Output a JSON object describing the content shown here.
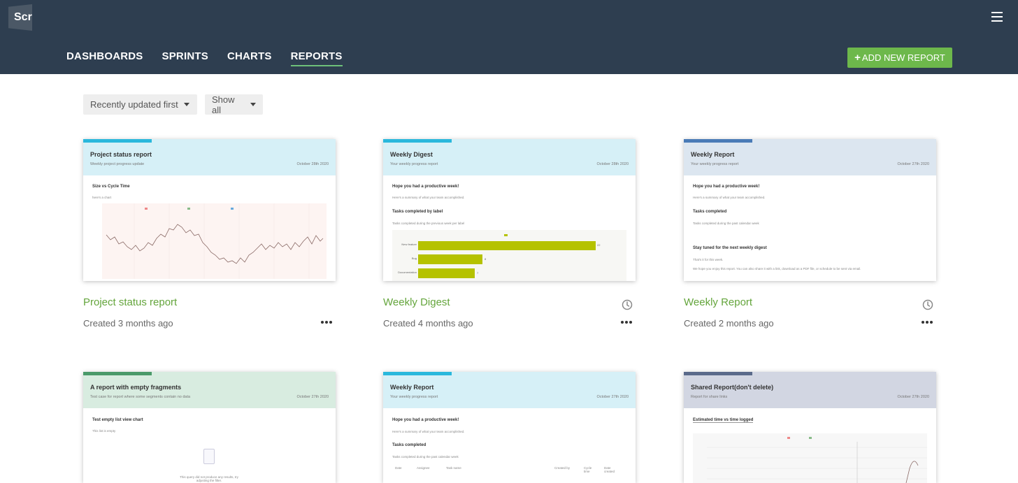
{
  "app": {
    "logo_text": "Scr"
  },
  "nav": {
    "items": [
      {
        "label": "DASHBOARDS"
      },
      {
        "label": "SPRINTS"
      },
      {
        "label": "CHARTS"
      },
      {
        "label": "REPORTS",
        "active": true
      }
    ],
    "add_button_label": "ADD NEW REPORT",
    "add_button_icon": "plus"
  },
  "filters": {
    "sort_selected": "Recently updated first",
    "show_selected": "Show all"
  },
  "colors": {
    "header_bg": "#2e3e50",
    "accent_green": "#6db84b",
    "title_green": "#64a53c"
  },
  "reports": [
    {
      "title": "Project status report",
      "created": "Created 3 months ago",
      "thumb": {
        "title": "Project status report",
        "subtitle": "Weekly project progress update",
        "date": "October 28th 2020",
        "header_color": "#d6f0f7",
        "bar_color": "#2ab8dc",
        "section": "Size vs Cycle Time",
        "note": "here's a chart"
      }
    },
    {
      "title": "Weekly Digest",
      "created": "Created 4 months ago",
      "scheduled": true,
      "thumb": {
        "title": "Weekly Digest",
        "subtitle": "Your weekly progress report",
        "date": "October 28th 2020",
        "header_color": "#d6f0f7",
        "bar_color": "#2ab8dc",
        "greeting": "Hope you had a productive week!",
        "greeting_note": "Here's a summary of what your team accomplished.",
        "section": "Tasks completed by label",
        "section_note": "Tasks completed during the previous week per label",
        "bars": [
          {
            "label": "New feature",
            "value": 22
          },
          {
            "label": "Bug",
            "value": 8
          },
          {
            "label": "Documentation",
            "value": 7
          }
        ]
      }
    },
    {
      "title": "Weekly Report",
      "created": "Created 2 months ago",
      "scheduled": true,
      "thumb": {
        "title": "Weekly Report",
        "subtitle": "Your weekly progress report",
        "date": "October 27th 2020",
        "header_color": "#dce6f0",
        "bar_color": "#4a7bb7",
        "greeting": "Hope you had a productive week!",
        "greeting_note": "Here's a summary of what your team accomplished.",
        "section": "Tasks completed",
        "section_note": "Tasks completed during the past calendar week",
        "footer_title": "Stay tuned for the next weekly digest",
        "footer_note": "That's it for this week.",
        "footer_note2": "We hope you enjoy this report. You can also share it with a link, download as a PDF file, or schedule to be sent via email."
      }
    },
    {
      "title": "",
      "created": "",
      "thumb": {
        "title": "A report with empty fragments",
        "subtitle": "Test case for report where some segments contain no data",
        "date": "October 27th 2020",
        "header_color": "#d8ece0",
        "bar_color": "#4a9a6a",
        "section": "Test empty list view chart",
        "section_note": "This list is empty",
        "empty_note": "This query did not produce any results, try adjusting the filter."
      }
    },
    {
      "title": "",
      "created": "",
      "thumb": {
        "title": "Weekly Report",
        "subtitle": "Your weekly progress report",
        "date": "October 27th 2020",
        "header_color": "#d6f0f7",
        "bar_color": "#2ab8dc",
        "greeting": "Hope you had a productive week!",
        "greeting_note": "Here's a summary of what your team accomplished.",
        "section": "Tasks completed",
        "section_note": "Tasks completed during the past calendar week",
        "columns": [
          "Date",
          "Assignee",
          "Task name",
          "Created by",
          "Cycle time",
          "Date created"
        ]
      }
    },
    {
      "title": "",
      "created": "",
      "thumb": {
        "title": "Shared Report(don't delete)",
        "subtitle": "Report for share links",
        "date": "October 27th 2020",
        "header_color": "#d2d6e2",
        "bar_color": "#5a6a8a",
        "section": "Estimated time vs time logged"
      }
    }
  ]
}
